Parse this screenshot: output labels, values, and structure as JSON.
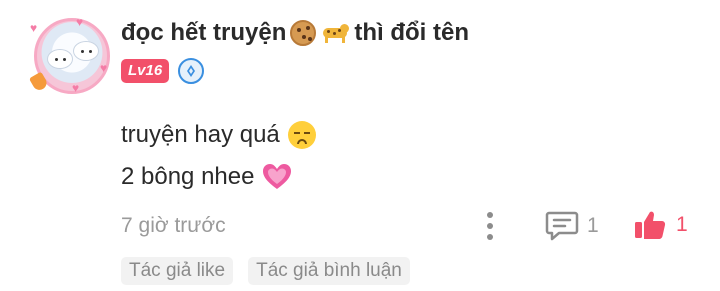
{
  "user": {
    "name": "đọc hết truyện",
    "name_suffix": "thì đổi tên",
    "level": "Lv16",
    "name_emojis": [
      "cookie-icon",
      "leopard-icon"
    ]
  },
  "comment": {
    "line1": "truyện hay quá",
    "line2": "2 bông nhee",
    "line1_emoji": "sad-face-icon",
    "line2_emoji": "pink-heart-icon"
  },
  "meta": {
    "time": "7 giờ trước",
    "reply_count": "1",
    "like_count": "1"
  },
  "tags": [
    {
      "label": "Tác giả like"
    },
    {
      "label": "Tác giả bình luận"
    }
  ],
  "colors": {
    "level_badge": "#f2506a",
    "like": "#f2506a",
    "vip_badge": "#3a8fe0",
    "muted": "#9a9a9a"
  }
}
